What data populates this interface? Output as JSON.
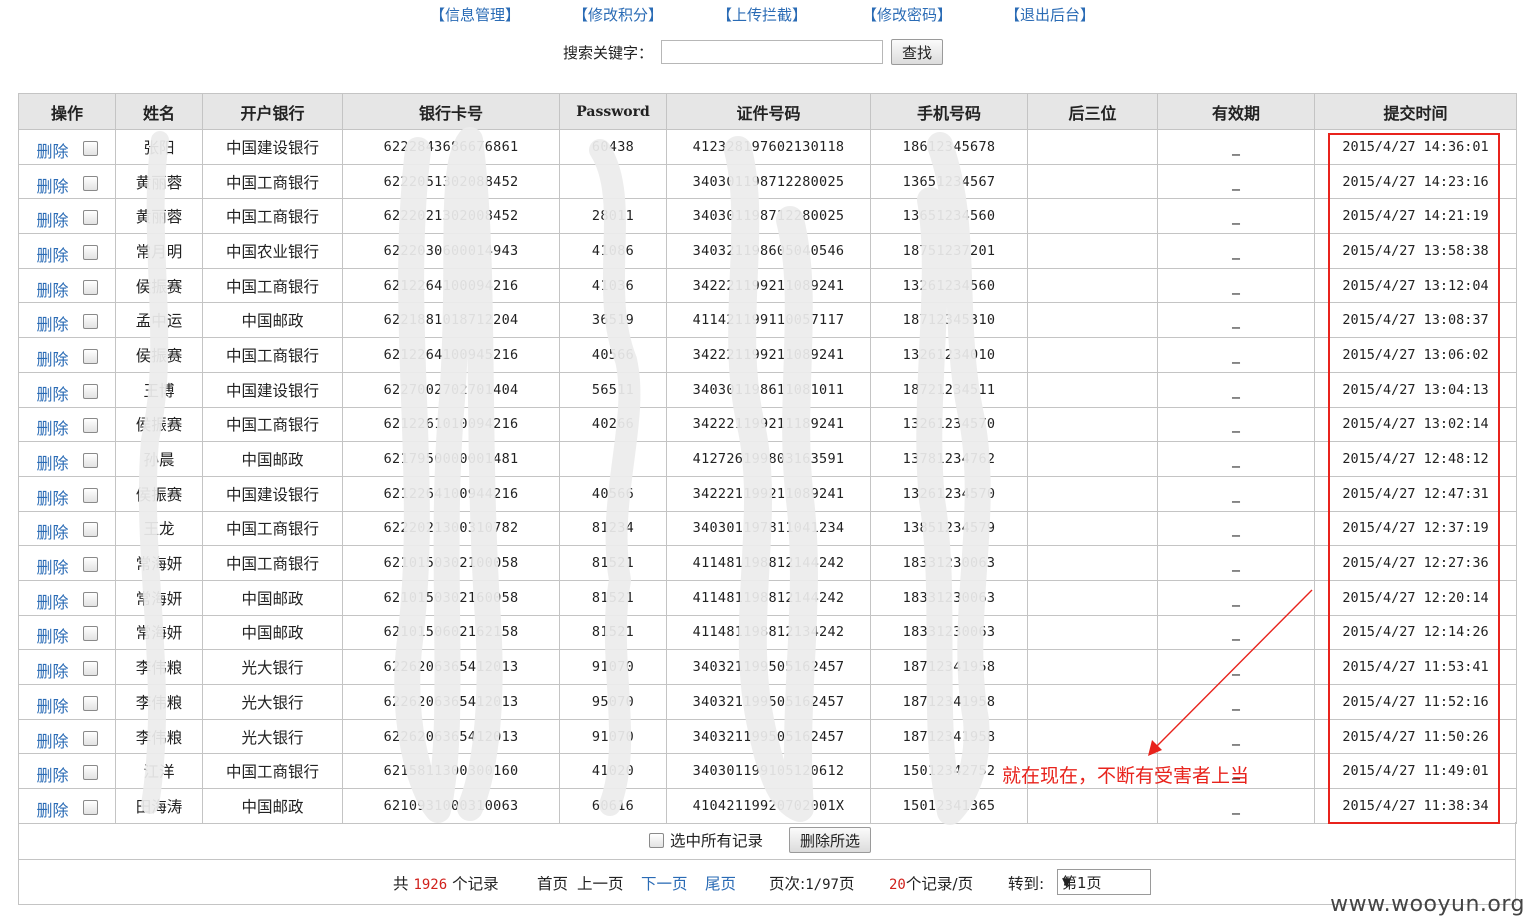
{
  "nav": [
    "【信息管理】",
    "【修改积分】",
    "【上传拦截】",
    "【修改密码】",
    "【退出后台】"
  ],
  "search": {
    "label": "搜索关键字：",
    "value": "",
    "button": "查找"
  },
  "table": {
    "headers": [
      "操作",
      "姓名",
      "开户银行",
      "银行卡号",
      "Password",
      "证件号码",
      "手机号码",
      "后三位",
      "有效期",
      "提交时间"
    ],
    "delete_label": "删除",
    "rows": [
      {
        "name": "张阳",
        "bank": "中国建设银行",
        "card": "6222843686676861",
        "password": "60438",
        "id": "412328197602130118",
        "phone": "18612345678",
        "cvv": "",
        "expiry": "_",
        "time": "2015/4/27 14:36:01"
      },
      {
        "name": "黄丽蓉",
        "bank": "中国工商银行",
        "card": "6222051302088452",
        "password": "",
        "id": "340301198712280025",
        "phone": "13651234567",
        "cvv": "",
        "expiry": "_",
        "time": "2015/4/27 14:23:16"
      },
      {
        "name": "黄丽蓉",
        "bank": "中国工商银行",
        "card": "6222021302008452",
        "password": "28011",
        "id": "340301198712280025",
        "phone": "13651234560",
        "cvv": "",
        "expiry": "_",
        "time": "2015/4/27 14:21:19"
      },
      {
        "name": "常月明",
        "bank": "中国农业银行",
        "card": "6222030600014943",
        "password": "41086",
        "id": "340321198605040546",
        "phone": "18751237201",
        "cvv": "",
        "expiry": "_",
        "time": "2015/4/27 13:58:38"
      },
      {
        "name": "侯振赛",
        "bank": "中国工商银行",
        "card": "6212264100094216",
        "password": "41036",
        "id": "342221199211089241",
        "phone": "13261234560",
        "cvv": "",
        "expiry": "_",
        "time": "2015/4/27 13:12:04"
      },
      {
        "name": "孟中运",
        "bank": "中国邮政",
        "card": "6221881018712204",
        "password": "36519",
        "id": "411421199110057117",
        "phone": "18712345310",
        "cvv": "",
        "expiry": "_",
        "time": "2015/4/27 13:08:37"
      },
      {
        "name": "侯振赛",
        "bank": "中国工商银行",
        "card": "6212264100945216",
        "password": "40566",
        "id": "342221199211089241",
        "phone": "13261234010",
        "cvv": "",
        "expiry": "_",
        "time": "2015/4/27 13:06:02"
      },
      {
        "name": "王博",
        "bank": "中国建设银行",
        "card": "6227002702701404",
        "password": "56511",
        "id": "340301198611081011",
        "phone": "18721234511",
        "cvv": "",
        "expiry": "_",
        "time": "2015/4/27 13:04:13"
      },
      {
        "name": "侯振赛",
        "bank": "中国工商银行",
        "card": "6212261010094216",
        "password": "40266",
        "id": "342221199211189241",
        "phone": "13261234570",
        "cvv": "",
        "expiry": "_",
        "time": "2015/4/27 13:02:14"
      },
      {
        "name": "孙晨",
        "bank": "中国邮政",
        "card": "6217950000001481",
        "password": "",
        "id": "412726199803163591",
        "phone": "13781234762",
        "cvv": "",
        "expiry": "_",
        "time": "2015/4/27 12:48:12"
      },
      {
        "name": "侯振赛",
        "bank": "中国建设银行",
        "card": "6212264100944216",
        "password": "40566",
        "id": "342221199211089241",
        "phone": "13261234570",
        "cvv": "",
        "expiry": "_",
        "time": "2015/4/27 12:47:31"
      },
      {
        "name": "王龙",
        "bank": "中国工商银行",
        "card": "6222021300310782",
        "password": "81234",
        "id": "340301197811041234",
        "phone": "13851234579",
        "cvv": "",
        "expiry": "_",
        "time": "2015/4/27 12:37:19"
      },
      {
        "name": "常海妍",
        "bank": "中国工商银行",
        "card": "6210150302100058",
        "password": "81521",
        "id": "411481198812144242",
        "phone": "18331230063",
        "cvv": "",
        "expiry": "_",
        "time": "2015/4/27 12:27:36"
      },
      {
        "name": "常海妍",
        "bank": "中国邮政",
        "card": "6210150302160058",
        "password": "81521",
        "id": "411481198812144242",
        "phone": "18331230063",
        "cvv": "",
        "expiry": "_",
        "time": "2015/4/27 12:20:14"
      },
      {
        "name": "常海妍",
        "bank": "中国邮政",
        "card": "6210150602162158",
        "password": "81521",
        "id": "411481198812134242",
        "phone": "18331230063",
        "cvv": "",
        "expiry": "_",
        "time": "2015/4/27 12:14:26"
      },
      {
        "name": "李伟粮",
        "bank": "光大银行",
        "card": "6226206365412013",
        "password": "91070",
        "id": "340321199505162457",
        "phone": "18712341958",
        "cvv": "",
        "expiry": "_",
        "time": "2015/4/27 11:53:41"
      },
      {
        "name": "李伟粮",
        "bank": "光大银行",
        "card": "6226206365412013",
        "password": "95070",
        "id": "340321199505162457",
        "phone": "18712341958",
        "cvv": "",
        "expiry": "_",
        "time": "2015/4/27 11:52:16"
      },
      {
        "name": "李伟粮",
        "bank": "光大银行",
        "card": "6226206365412013",
        "password": "91070",
        "id": "340321199505162457",
        "phone": "18712341958",
        "cvv": "",
        "expiry": "_",
        "time": "2015/4/27 11:50:26"
      },
      {
        "name": "江洋",
        "bank": "中国工商银行",
        "card": "6215811300300160",
        "password": "41020",
        "id": "340301199105120612",
        "phone": "15012342752",
        "cvv": "",
        "expiry": "_",
        "time": "2015/4/27 11:49:01"
      },
      {
        "name": "田海涛",
        "bank": "中国邮政",
        "card": "6210931000310063",
        "password": "60616",
        "id": "41042119920702001X",
        "phone": "15012341365",
        "cvv": "",
        "expiry": "_",
        "time": "2015/4/27 11:38:34"
      }
    ]
  },
  "actions": {
    "select_all": "选中所有记录",
    "delete_selected": "删除所选"
  },
  "pager": {
    "total_prefix": "共",
    "total": "1926",
    "total_suffix": "个记录",
    "first": "首页",
    "prev": "上一页",
    "next": "下一页",
    "last": "尾页",
    "page_label": "页次:",
    "page_value": "1/97",
    "page_suffix": "页",
    "per_page": "20",
    "per_page_suffix": "个记录/页",
    "goto_label": "转到:",
    "goto_value": "第1页"
  },
  "annotation": "就在现在，不断有受害者上当",
  "watermark": "www.wooyun.org",
  "colors": {
    "link": "#2a6bb5",
    "highlight": "#e8231c",
    "count": "#d0211c",
    "header_bg": "#e6e6e6"
  }
}
